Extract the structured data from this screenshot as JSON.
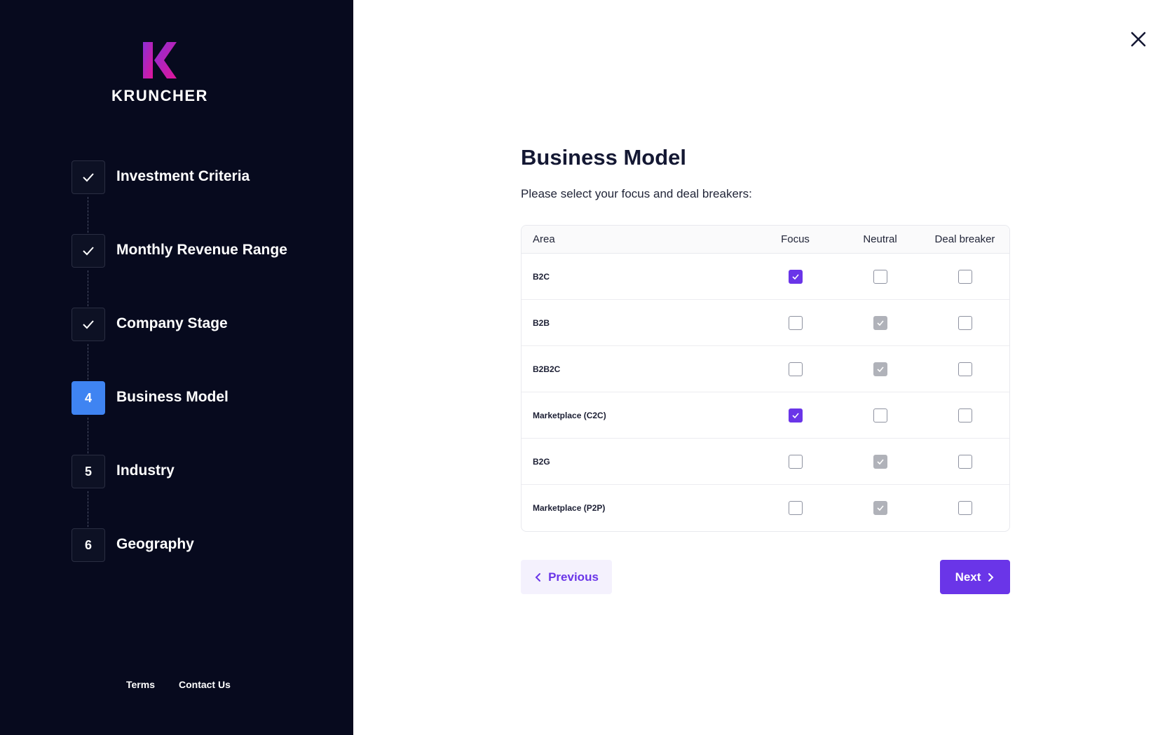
{
  "brand": {
    "name": "KRUNCHER",
    "gradient_start": "#8b2fd6",
    "gradient_end": "#e0159a"
  },
  "sidebar": {
    "steps": [
      {
        "label": "Investment Criteria",
        "status": "completed",
        "indicator": "check-icon"
      },
      {
        "label": "Monthly Revenue Range",
        "status": "completed",
        "indicator": "check-icon"
      },
      {
        "label": "Company Stage",
        "status": "completed",
        "indicator": "check-icon"
      },
      {
        "label": "Business Model",
        "status": "active",
        "number": "4"
      },
      {
        "label": "Industry",
        "status": "pending",
        "number": "5"
      },
      {
        "label": "Geography",
        "status": "pending",
        "number": "6"
      }
    ],
    "footer": {
      "terms": "Terms",
      "contact": "Contact Us"
    }
  },
  "main": {
    "title": "Business Model",
    "subtitle": "Please select your focus and deal breakers:",
    "table": {
      "headers": {
        "area": "Area",
        "focus": "Focus",
        "neutral": "Neutral",
        "deal_breaker": "Deal breaker"
      },
      "rows": [
        {
          "area": "B2C",
          "selected": "focus"
        },
        {
          "area": "B2B",
          "selected": "neutral"
        },
        {
          "area": "B2B2C",
          "selected": "neutral"
        },
        {
          "area": "Marketplace (C2C)",
          "selected": "focus"
        },
        {
          "area": "B2G",
          "selected": "neutral"
        },
        {
          "area": "Marketplace (P2P)",
          "selected": "neutral"
        }
      ]
    },
    "buttons": {
      "previous": "Previous",
      "next": "Next"
    }
  },
  "colors": {
    "sidebar_bg": "#070a1e",
    "active_step": "#3f84f2",
    "accent": "#6a35e8",
    "neutral_check": "#b0b2b9"
  }
}
